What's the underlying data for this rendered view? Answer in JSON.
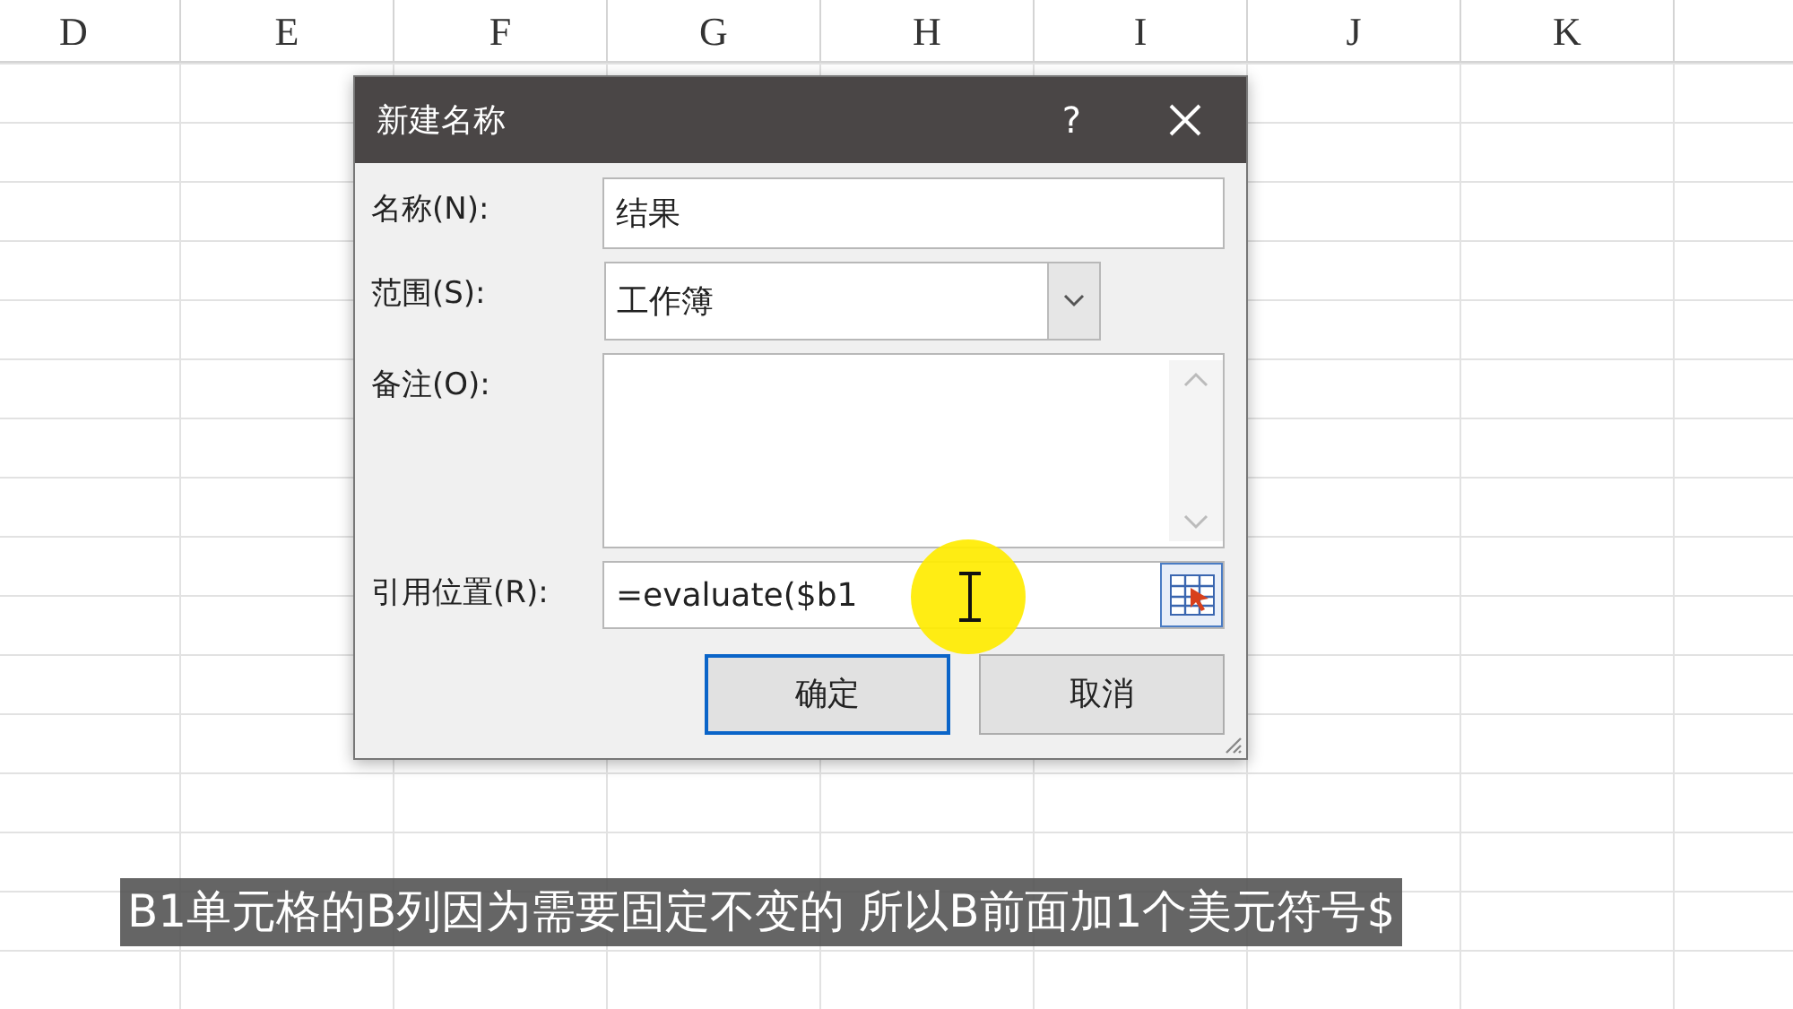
{
  "sheet": {
    "columns": [
      "D",
      "E",
      "F",
      "G",
      "H",
      "I",
      "J",
      "K"
    ]
  },
  "dialog": {
    "title": "新建名称",
    "help": "?",
    "fields": [
      {
        "kind": "text",
        "label": "名称(N):",
        "value": "结果"
      },
      {
        "kind": "select",
        "label": "范围(S):",
        "value": "工作簿"
      },
      {
        "kind": "textarea",
        "label": "备注(O):"
      },
      {
        "kind": "reference",
        "label": "引用位置(R):",
        "value": "=evaluate($b1"
      }
    ],
    "buttons": [
      {
        "label": "确定",
        "default": true
      },
      {
        "label": "取消",
        "default": false
      }
    ]
  },
  "subtitle": "B1单元格的B列因为需要固定不变的 所以B前面加1个美元符号$"
}
